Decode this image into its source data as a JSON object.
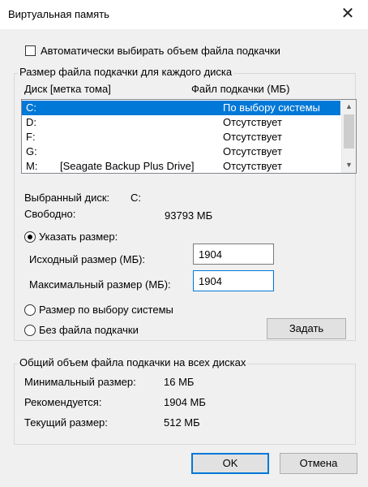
{
  "window": {
    "title": "Виртуальная память",
    "close_glyph": "✕"
  },
  "auto_manage": {
    "label": "Автоматически выбирать объем файла подкачки",
    "checked": false
  },
  "per_drive": {
    "group_title": "Размер файла подкачки для каждого диска",
    "col_drive": "Диск [метка тома]",
    "col_file": "Файл подкачки (МБ)",
    "rows": [
      {
        "drive": "C:",
        "label": "",
        "file": "По выбору системы",
        "selected": true
      },
      {
        "drive": "D:",
        "label": "",
        "file": "Отсутствует",
        "selected": false
      },
      {
        "drive": "F:",
        "label": "",
        "file": "Отсутствует",
        "selected": false
      },
      {
        "drive": "G:",
        "label": "",
        "file": "Отсутствует",
        "selected": false
      },
      {
        "drive": "M:",
        "label": "[Seagate Backup Plus Drive]",
        "file": "Отсутствует",
        "selected": false
      }
    ],
    "scroll_up": "▲",
    "scroll_down": "▼",
    "selected_disk_label": "Выбранный диск:",
    "selected_disk_value": "C:",
    "free_label": "Свободно:",
    "free_value": "93793 МБ",
    "custom_size_label": "Указать размер:",
    "initial_label": "Исходный размер (МБ):",
    "initial_value": "1904",
    "max_label": "Максимальный размер (МБ):",
    "max_value": "1904",
    "system_managed_label": "Размер по выбору системы",
    "no_file_label": "Без файла подкачки",
    "set_button": "Задать",
    "selected_option": "custom"
  },
  "total": {
    "group_title": "Общий объем файла подкачки на всех дисках",
    "min_label": "Минимальный размер:",
    "min_value": "16 МБ",
    "recommended_label": "Рекомендуется:",
    "recommended_value": "1904 МБ",
    "current_label": "Текущий размер:",
    "current_value": "512 МБ"
  },
  "footer": {
    "ok": "OK",
    "cancel": "Отмена"
  }
}
